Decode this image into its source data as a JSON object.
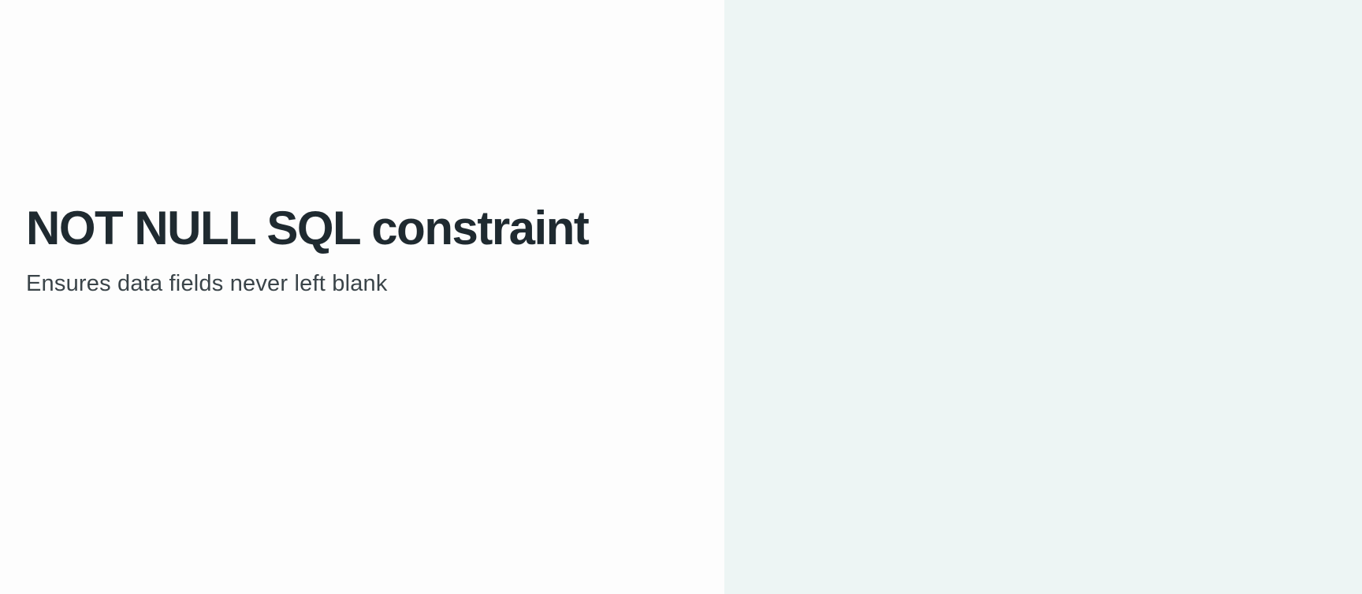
{
  "slide": {
    "title": "NOT NULL SQL constraint",
    "subtitle": "Ensures data fields never left blank"
  },
  "colors": {
    "left_background": "#fdfdfd",
    "right_background": "#edf5f4",
    "title_text": "#1f2a30",
    "subtitle_text": "#3a4449"
  }
}
